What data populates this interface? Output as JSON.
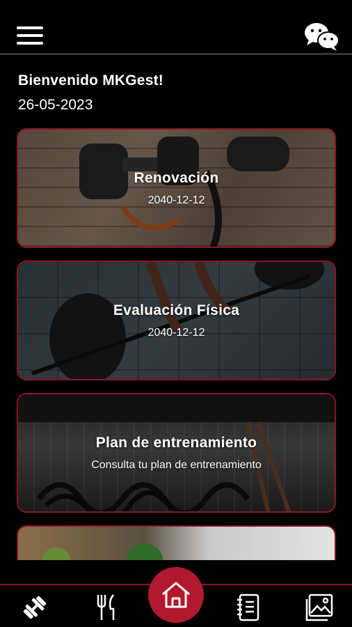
{
  "header": {
    "menu_icon": "hamburger-menu-icon",
    "chat_icon": "wechat-icon"
  },
  "welcome": {
    "greeting": "Bienvenido MKGest!",
    "date": "26-05-2023"
  },
  "cards": [
    {
      "title": "Renovación",
      "subtitle": "2040-12-12"
    },
    {
      "title": "Evaluación Física",
      "subtitle": "2040-12-12"
    },
    {
      "title": "Plan de entrenamiento",
      "subtitle": "Consulta tu plan de entrenamiento"
    },
    {
      "title": "",
      "subtitle": ""
    }
  ],
  "bottom_nav": {
    "items": [
      "dumbbell-icon",
      "fork-knife-icon",
      "home-icon",
      "notebook-icon",
      "gallery-icon"
    ],
    "accent": "#b3192e",
    "border": "#8d1424"
  }
}
